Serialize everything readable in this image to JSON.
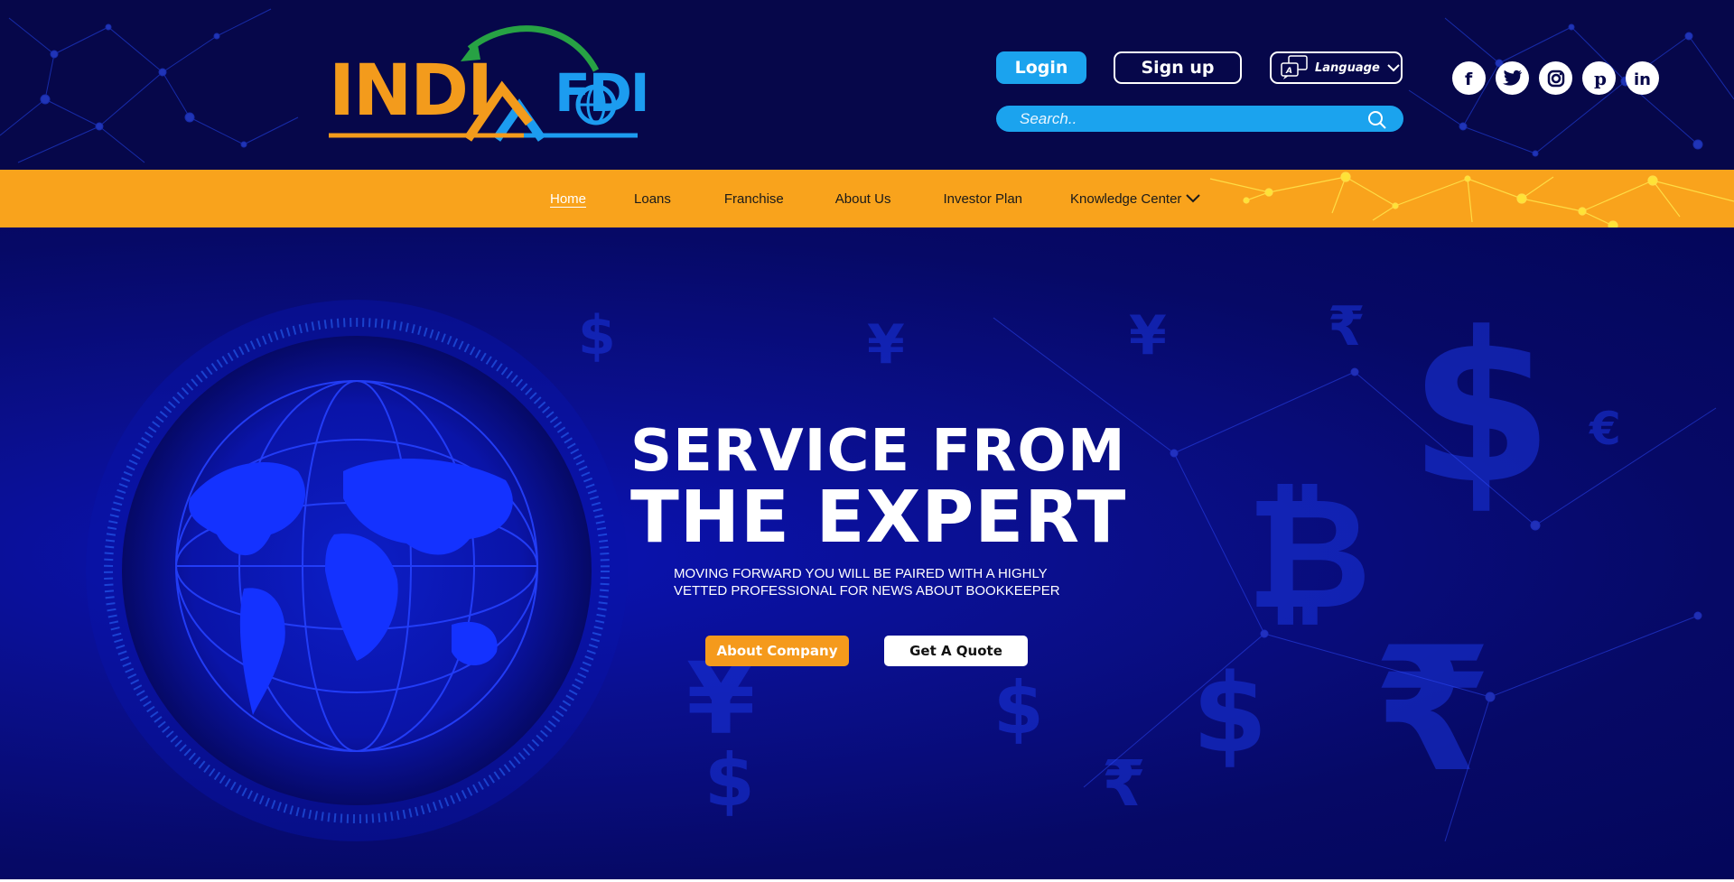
{
  "brand": {
    "part1": "INDI",
    "part2": "FDI"
  },
  "header": {
    "login_label": "Login",
    "signup_label": "Sign up",
    "language_label": "Language",
    "search_placeholder": "Search..",
    "social_icons": [
      "facebook-icon",
      "twitter-icon",
      "instagram-icon",
      "pinterest-icon",
      "linkedin-icon"
    ]
  },
  "nav": {
    "items": [
      "Home",
      "Loans",
      "Franchise",
      "About Us",
      "Investor Plan",
      "Knowledge Center"
    ]
  },
  "hero": {
    "title_line1": "SERVICE FROM",
    "title_line2": "THE EXPERT",
    "subtitle_line1": "MOVING FORWARD YOU WILL BE PAIRED WITH A HIGHLY",
    "subtitle_line2": "VETTED PROFESSIONAL FOR NEWS ABOUT BOOKKEEPER",
    "about_button": "About Company",
    "quote_button": "Get A Quote"
  },
  "colors": {
    "header_bg": "#06074a",
    "nav_bg": "#f9a31c",
    "accent_blue": "#1ba3ee",
    "accent_orange": "#f59a1c"
  }
}
